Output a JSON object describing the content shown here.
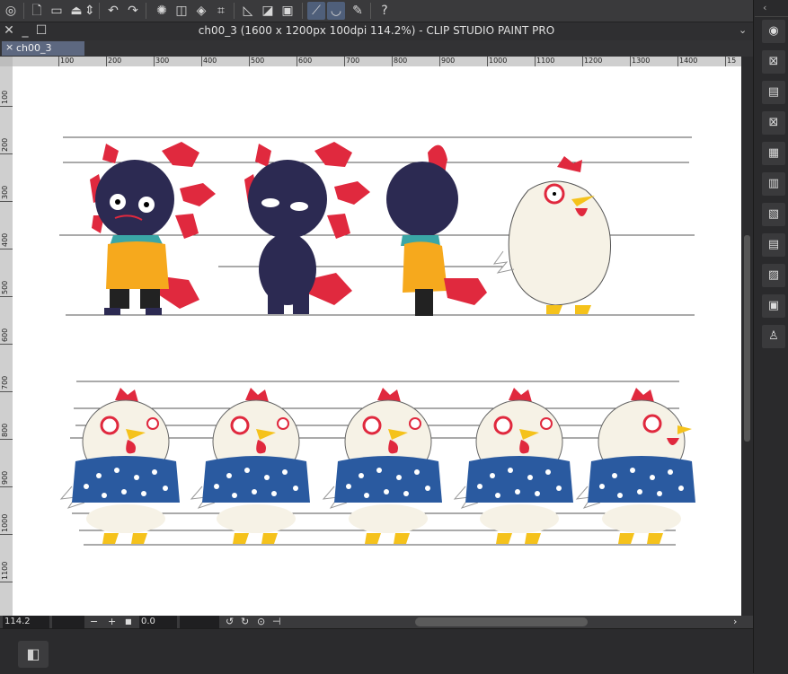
{
  "app": {
    "title": "ch00_3 (1600 x 1200px 100dpi 114.2%)  - CLIP STUDIO PAINT PRO",
    "tab_label": "ch00_3",
    "tab_close": "×"
  },
  "window_buttons": {
    "close": "✕",
    "minimize": "_",
    "maximize": "☐"
  },
  "toolbar_icons": [
    "clip-studio-menu-icon",
    "new-file-icon",
    "open-folder-icon",
    "save-cloud-icon",
    "chevron-updown-icon",
    "undo-icon",
    "redo-icon",
    "busy-spinner-icon",
    "transform-icon",
    "fill-icon",
    "crop-icon",
    "snap-ruler-icon",
    "snap-grid-icon",
    "snap-perspective-icon",
    "ruler-snap-icon",
    "special-ruler-icon",
    "pen-pressure-icon",
    "help-icon"
  ],
  "ruler": {
    "h_labels": [
      "100",
      "200",
      "300",
      "400",
      "500",
      "600",
      "700",
      "800",
      "900",
      "1000",
      "1100",
      "1200",
      "1300",
      "1400",
      "15"
    ],
    "v_labels": [
      "100",
      "200",
      "300",
      "400",
      "500",
      "600",
      "700",
      "800",
      "900",
      "1000",
      "1100"
    ]
  },
  "status": {
    "zoom": "114.2",
    "rotation": "0.0",
    "minus": "−",
    "plus": "+",
    "fit": "■"
  },
  "right_panel_icons": [
    "navigator-icon",
    "sub-view-icon",
    "layer-property-icon",
    "close-panel-icon",
    "material-icon",
    "layer-search-icon",
    "color-set-icon",
    "layer-icon",
    "auto-action-icon",
    "item-bank-icon",
    "character-pose-icon"
  ],
  "colors": {
    "accent": "#5d6880",
    "red": "#e0293e",
    "navy": "#2c2a52",
    "kimono": "#2a5aa0",
    "yellow": "#f5c21b",
    "coat": "#f6a91d",
    "teal": "#3aa6a6"
  }
}
